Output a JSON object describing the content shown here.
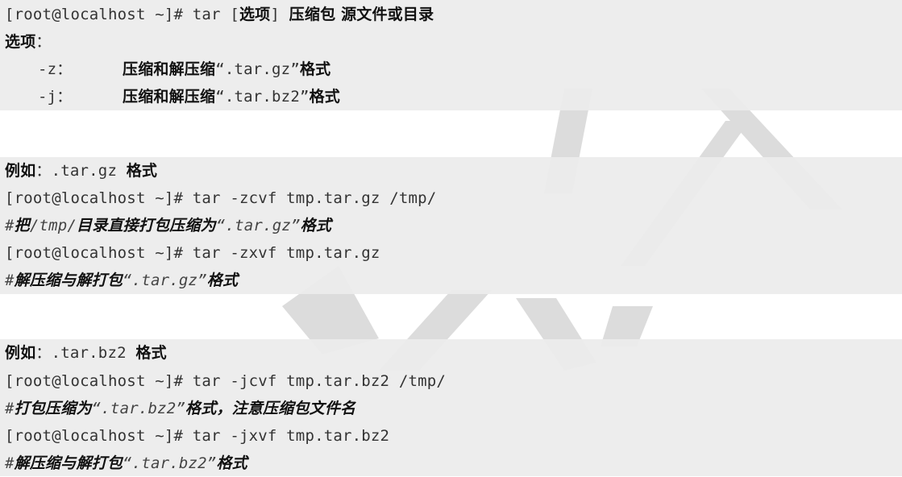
{
  "block1": {
    "line1": {
      "prompt": "[root@localhost ~]# tar [",
      "opt": "选项",
      "mid": "] ",
      "args": "压缩包 源文件或目录"
    },
    "line2": {
      "label": "选项",
      "colon": "："
    },
    "line3": {
      "flag": "-z：",
      "desc_a": "压缩和解压缩",
      "desc_b": "“.tar.gz”",
      "desc_c": "格式"
    },
    "line4": {
      "flag": "-j：",
      "desc_a": "压缩和解压缩",
      "desc_b": "“.tar.bz2”",
      "desc_c": "格式"
    }
  },
  "block2": {
    "example": {
      "label": "例如",
      "colon": "：",
      "ext": ".tar.gz ",
      "suffix": "格式"
    },
    "cmd1": "[root@localhost ~]# tar -zcvf tmp.tar.gz /tmp/",
    "comment1": {
      "hash": "#",
      "a": "把",
      "b": "/tmp/",
      "c": "目录直接打包压缩为",
      "d": "“.tar.gz”",
      "e": "格式"
    },
    "cmd2": "[root@localhost ~]# tar -zxvf tmp.tar.gz",
    "comment2": {
      "hash": "#",
      "a": "解压缩与解打包",
      "b": "“.tar.gz”",
      "c": "格式"
    }
  },
  "block3": {
    "example": {
      "label": "例如",
      "colon": "：",
      "ext": ".tar.bz2 ",
      "suffix": "格式"
    },
    "cmd1": "[root@localhost ~]# tar -jcvf tmp.tar.bz2 /tmp/",
    "comment1": {
      "hash": "#",
      "a": "打包压缩为",
      "b": "“.tar.bz2”",
      "c": "格式，注意压缩包文件名"
    },
    "cmd2": "[root@localhost ~]# tar -jxvf tmp.tar.bz2",
    "comment2": {
      "hash": "#",
      "a": "解压缩与解打包",
      "b": "“.tar.bz2”",
      "c": "格式"
    }
  },
  "colors": {
    "block_background": "#ececec",
    "watermark": "#dcdcdc",
    "text": "#333333"
  }
}
